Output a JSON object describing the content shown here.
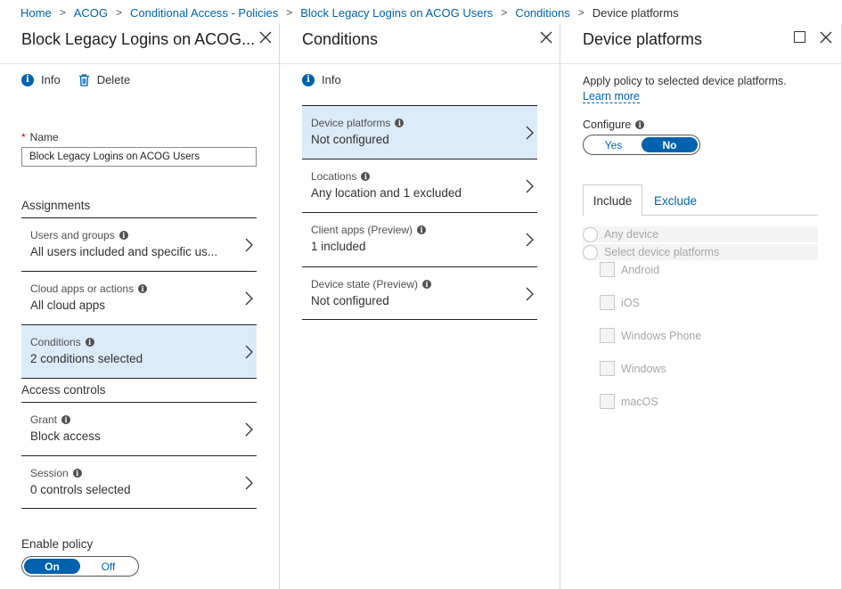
{
  "breadcrumb": [
    "Home",
    "ACOG",
    "Conditional Access - Policies",
    "Block Legacy Logins on ACOG Users",
    "Conditions",
    "Device platforms"
  ],
  "policy_blade": {
    "title": "Block Legacy Logins on ACOG...",
    "commands": {
      "info": "Info",
      "delete": "Delete"
    },
    "name_label": "Name",
    "name_value": "Block Legacy Logins on ACOG Users",
    "assignments_title": "Assignments",
    "assignments": [
      {
        "label": "Users and groups",
        "value": "All users included and specific us..."
      },
      {
        "label": "Cloud apps or actions",
        "value": "All cloud apps"
      },
      {
        "label": "Conditions",
        "value": "2 conditions selected"
      }
    ],
    "access_title": "Access controls",
    "access": [
      {
        "label": "Grant",
        "value": "Block access"
      },
      {
        "label": "Session",
        "value": "0 controls selected"
      }
    ],
    "enable_label": "Enable policy",
    "enable_on": "On",
    "enable_off": "Off"
  },
  "conditions_blade": {
    "title": "Conditions",
    "info": "Info",
    "items": [
      {
        "label": "Device platforms",
        "value": "Not configured"
      },
      {
        "label": "Locations",
        "value": "Any location and 1 excluded"
      },
      {
        "label": "Client apps (Preview)",
        "value": "1 included"
      },
      {
        "label": "Device state (Preview)",
        "value": "Not configured"
      }
    ]
  },
  "device_blade": {
    "title": "Device platforms",
    "description": "Apply policy to selected device platforms.",
    "learn_more": "Learn more",
    "configure_label": "Configure",
    "configure_yes": "Yes",
    "configure_no": "No",
    "tabs": [
      "Include",
      "Exclude"
    ],
    "radios": [
      "Any device",
      "Select device platforms"
    ],
    "platforms": [
      "Android",
      "iOS",
      "Windows Phone",
      "Windows",
      "macOS"
    ]
  },
  "colors": {
    "accent": "#0062ad",
    "selected": "#dcebfa"
  }
}
